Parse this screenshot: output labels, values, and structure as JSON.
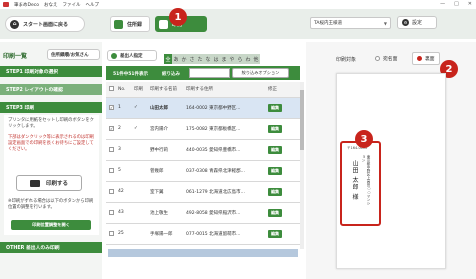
{
  "titlebar": {
    "app_title": "筆まめDeco",
    "menu": [
      "おなえ",
      "ファイル",
      "ヘルプ"
    ]
  },
  "topbar": {
    "start_button": "スタート画面に戻る",
    "tabs": [
      {
        "label": "住所録",
        "active": false
      },
      {
        "label": "印刷",
        "active": true
      }
    ],
    "marker1": "1",
    "printer_select": "TA桜内王様道",
    "settings_button": "設定"
  },
  "left": {
    "title": "印刷一覧",
    "sort_button": "住所録順/お気さん",
    "step1": "STEP1 印刷対象の選択",
    "step2": "STEP2 レイアウトの確認",
    "step3": "STEP3 印刷",
    "step3_desc": "プリンタに用紙をセットし印刷のボタンをクリックします。",
    "step3_red": "下部はダンクリック等に表示されるのは印刷設定画面での印刷を長くお待ちにご設定してください。",
    "print_button": "印刷する",
    "step3_note": "※印刷がずれる場合は以下のボタンから印刷位置の調整を行います。",
    "check_button": "印刷位置調整を開く",
    "other": "OTHER 差出人のみ印刷"
  },
  "center": {
    "sender_button": "差出人指定",
    "kana": [
      "全",
      "あ",
      "か",
      "さ",
      "た",
      "な",
      "は",
      "ま",
      "や",
      "ら",
      "わ",
      "他"
    ],
    "count_text": "51件中51件表示",
    "narrow_label": "絞り込み",
    "narrow_button": "絞り込みオプション",
    "headers": [
      "",
      "No.",
      "印刷",
      "印刷する名前",
      "印刷する住所",
      "修正"
    ],
    "rows": [
      {
        "no": "1",
        "check": "✓",
        "name": "山田太郎",
        "addr": "164-0002 東京都中野区...",
        "edit": "編集",
        "selected": true
      },
      {
        "no": "2",
        "check": "✓",
        "name": "宮内陽介",
        "addr": "175-0082 東京都板橋区...",
        "edit": "編集",
        "selected": false
      },
      {
        "no": "3",
        "check": "",
        "name": "野中行莉",
        "addr": "440-0035 愛知県豊橋市...",
        "edit": "編集",
        "selected": false
      },
      {
        "no": "5",
        "check": "",
        "name": "菅幾郎",
        "addr": "037-0308 青森県北津軽郡...",
        "edit": "編集",
        "selected": false
      },
      {
        "no": "42",
        "check": "",
        "name": "室下翼",
        "addr": "061-1279 北海道北広島市...",
        "edit": "編集",
        "selected": false
      },
      {
        "no": "43",
        "check": "",
        "name": "池上敬生",
        "addr": "492-8058 愛知県稲沢市...",
        "edit": "編集",
        "selected": false
      },
      {
        "no": "25",
        "check": "",
        "name": "手塚陽一郎",
        "addr": "077-0015 北海道留萌市...",
        "edit": "編集",
        "selected": false
      }
    ]
  },
  "right": {
    "target_label": "印刷対象",
    "options": [
      {
        "label": "宛名面",
        "active": false
      },
      {
        "label": "裏面",
        "active": true
      }
    ],
    "marker2": "2",
    "marker3": "3",
    "preview": {
      "zip": "〒164-0002",
      "address": "東京都中野区上高田○○マンション",
      "name": "山田 太郎 様"
    }
  },
  "colors": {
    "accent": "#3d8c3d",
    "marker": "#c8241c",
    "selection": "#d9e5f3"
  }
}
